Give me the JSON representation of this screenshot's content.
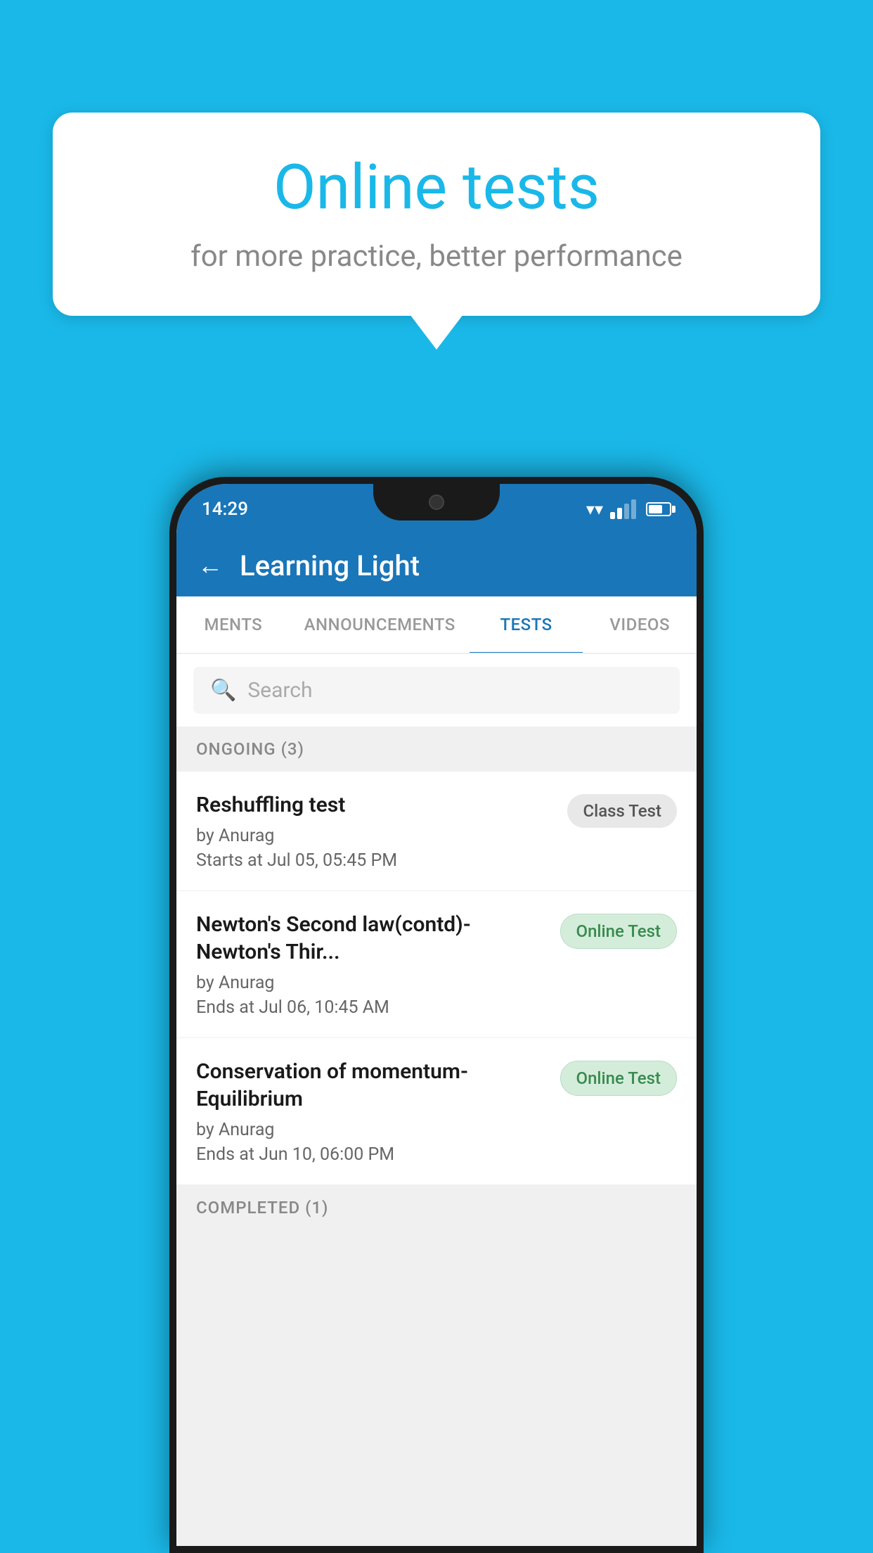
{
  "background_color": "#1ab8e8",
  "bubble": {
    "title": "Online tests",
    "subtitle": "for more practice, better performance"
  },
  "phone": {
    "status_bar": {
      "time": "14:29"
    },
    "app_header": {
      "title": "Learning Light"
    },
    "tabs": [
      {
        "label": "MENTS",
        "active": false
      },
      {
        "label": "ANNOUNCEMENTS",
        "active": false
      },
      {
        "label": "TESTS",
        "active": true
      },
      {
        "label": "VIDEOS",
        "active": false
      }
    ],
    "search": {
      "placeholder": "Search"
    },
    "ongoing_section": {
      "label": "ONGOING (3)"
    },
    "tests": [
      {
        "title": "Reshuffling test",
        "author": "by Anurag",
        "date": "Starts at  Jul 05, 05:45 PM",
        "badge": "Class Test",
        "badge_type": "class"
      },
      {
        "title": "Newton's Second law(contd)-Newton's Thir...",
        "author": "by Anurag",
        "date": "Ends at  Jul 06, 10:45 AM",
        "badge": "Online Test",
        "badge_type": "online"
      },
      {
        "title": "Conservation of momentum-Equilibrium",
        "author": "by Anurag",
        "date": "Ends at  Jun 10, 06:00 PM",
        "badge": "Online Test",
        "badge_type": "online"
      }
    ],
    "completed_section": {
      "label": "COMPLETED (1)"
    }
  }
}
